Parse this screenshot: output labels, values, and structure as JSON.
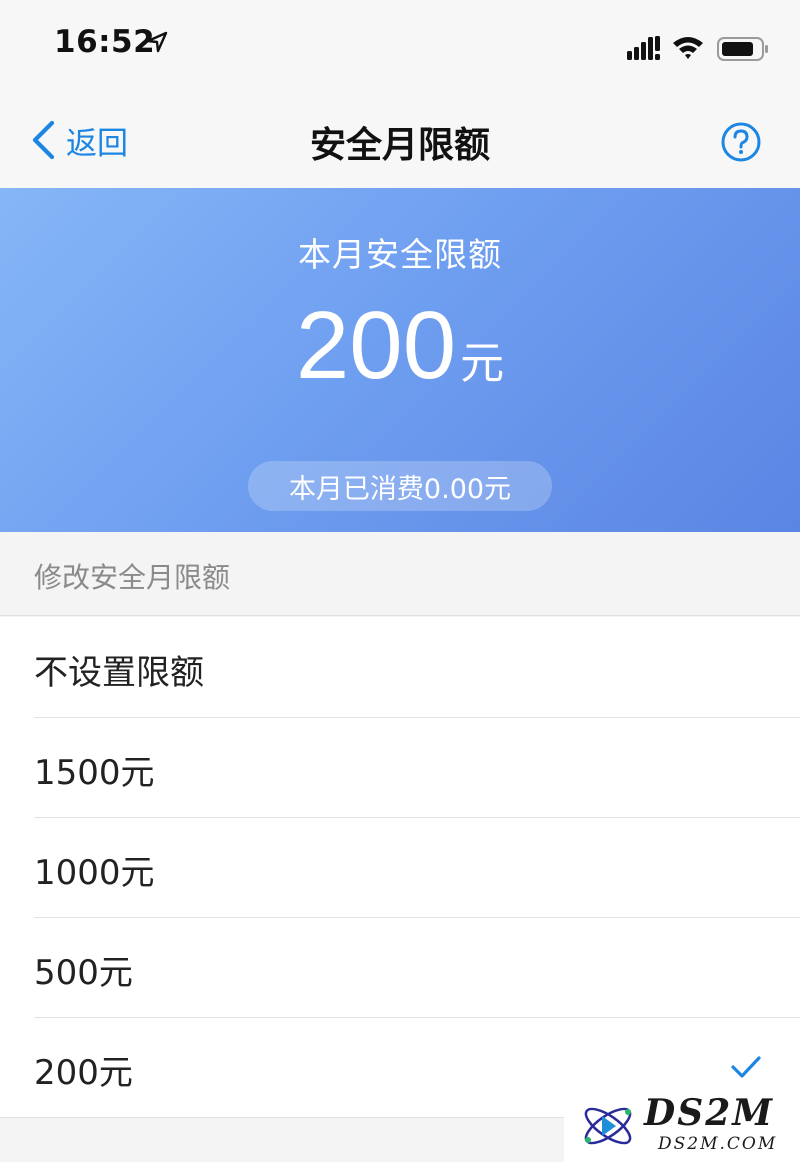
{
  "status_bar": {
    "time": "16:52",
    "icons": [
      "location-arrow-icon",
      "signal-icon",
      "wifi-icon",
      "battery-icon"
    ]
  },
  "nav": {
    "back_label": "返回",
    "title": "安全月限额",
    "help_icon": "question-circle-icon"
  },
  "hero": {
    "label": "本月安全限额",
    "amount": "200",
    "unit": "元",
    "spent": "本月已消费0.00元"
  },
  "section": {
    "header": "修改安全月限额"
  },
  "options": [
    {
      "label": "不设置限额",
      "selected": false
    },
    {
      "label": "1500元",
      "selected": false
    },
    {
      "label": "1000元",
      "selected": false
    },
    {
      "label": "500元",
      "selected": false
    },
    {
      "label": "200元",
      "selected": true
    }
  ],
  "watermark": {
    "title": "DS2M",
    "subtitle": "DS2M.COM"
  },
  "colors": {
    "accent": "#1c86e2",
    "hero_gradient_start": "#86b6f6",
    "hero_gradient_end": "#5b85e3",
    "page_bg": "#f4f4f4"
  }
}
